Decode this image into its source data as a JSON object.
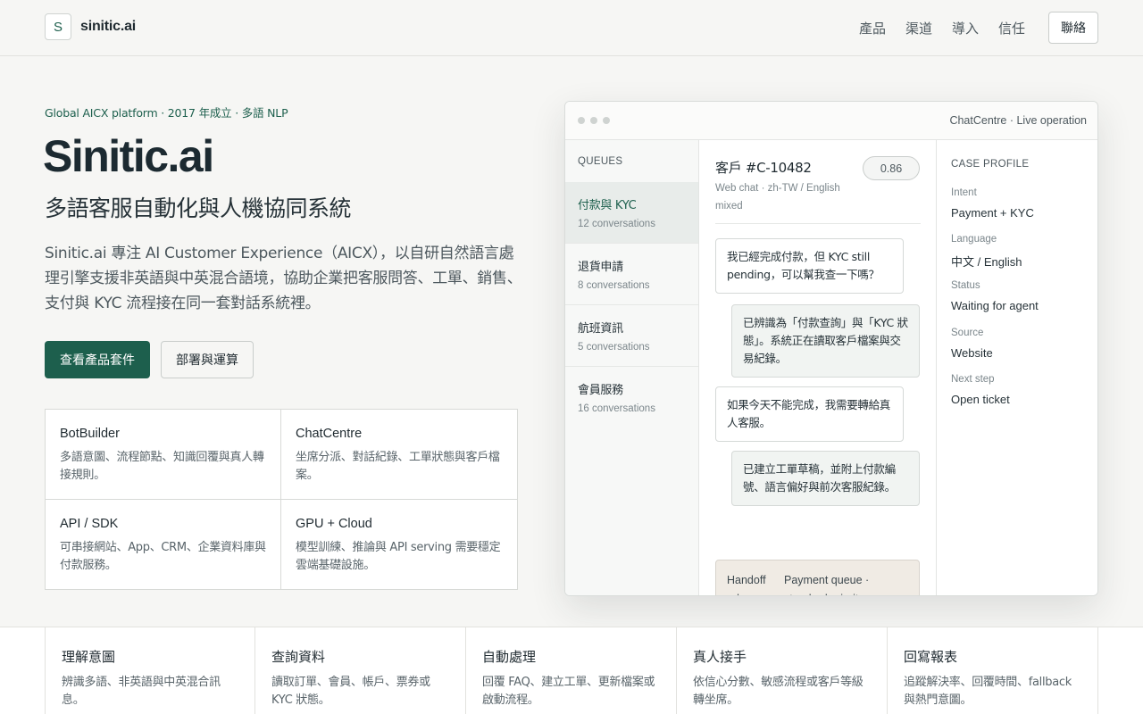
{
  "header": {
    "logo_letter": "S",
    "brand": "sinitic.ai",
    "nav": [
      "產品",
      "渠道",
      "導入",
      "信任"
    ],
    "contact_label": "聯絡"
  },
  "hero": {
    "eyebrow": "Global AICX platform · 2017 年成立 · 多語 NLP",
    "title": "Sinitic.ai",
    "subtitle": "多語客服自動化與人機協同系統",
    "description": "Sinitic.ai 專注 AI Customer Experience（AICX），以自研自然語言處理引擎支援非英語與中英混合語境，協助企業把客服問答、工單、銷售、支付與 KYC 流程接在同一套對話系統裡。",
    "primary_button": "查看產品套件",
    "secondary_button": "部署與運算"
  },
  "products": [
    {
      "name": "BotBuilder",
      "desc": "多語意圖、流程節點、知識回覆與真人轉接規則。"
    },
    {
      "name": "ChatCentre",
      "desc": "坐席分派、對話紀錄、工單狀態與客戶檔案。"
    },
    {
      "name": "API / SDK",
      "desc": "可串接網站、App、CRM、企業資料庫與付款服務。"
    },
    {
      "name": "GPU + Cloud",
      "desc": "模型訓練、推論與 API serving 需要穩定雲端基礎設施。"
    }
  ],
  "window": {
    "title": "ChatCentre · Live operation",
    "queues_heading": "QUEUES",
    "queues": [
      {
        "name": "付款與 KYC",
        "count": "12 conversations",
        "active": true
      },
      {
        "name": "退貨申請",
        "count": "8 conversations",
        "active": false
      },
      {
        "name": "航班資訊",
        "count": "5 conversations",
        "active": false
      },
      {
        "name": "會員服務",
        "count": "16 conversations",
        "active": false
      }
    ],
    "customer": {
      "id": "客戶 #C-10482",
      "meta": "Web chat · zh-TW / English mixed",
      "score": "0.86"
    },
    "messages": [
      {
        "role": "user",
        "text": "我已經完成付款，但 KYC still pending，可以幫我查一下嗎？"
      },
      {
        "role": "bot",
        "text": "已辨識為「付款查詢」與「KYC 狀態」。系統正在讀取客戶檔案與交易紀錄。"
      },
      {
        "role": "user",
        "text": "如果今天不能完成，我需要轉給真人客服。"
      },
      {
        "role": "bot",
        "text": "已建立工單草稿，並附上付款編號、語言偏好與前次客服紀錄。"
      }
    ],
    "handoff": {
      "label": "Handoff rule",
      "value": "Payment queue · standard priority"
    },
    "profile": {
      "heading": "CASE PROFILE",
      "fields": [
        {
          "label": "Intent",
          "value": "Payment + KYC"
        },
        {
          "label": "Language",
          "value": "中文 / English"
        },
        {
          "label": "Status",
          "value": "Waiting for agent"
        },
        {
          "label": "Source",
          "value": "Website"
        },
        {
          "label": "Next step",
          "value": "Open ticket"
        }
      ]
    }
  },
  "steps": [
    {
      "title": "理解意圖",
      "desc": "辨識多語、非英語與中英混合訊息。"
    },
    {
      "title": "查詢資料",
      "desc": "讀取訂單、會員、帳戶、票券或 KYC 狀態。"
    },
    {
      "title": "自動處理",
      "desc": "回覆 FAQ、建立工單、更新檔案或啟動流程。"
    },
    {
      "title": "真人接手",
      "desc": "依信心分數、敏感流程或客戶等級轉坐席。"
    },
    {
      "title": "回寫報表",
      "desc": "追蹤解決率、回覆時間、fallback 與熱門意圖。"
    }
  ],
  "colors": {
    "accent": "#1d5f4d",
    "background": "#f6f6f4",
    "handoff_bg": "#f0ebe4"
  }
}
